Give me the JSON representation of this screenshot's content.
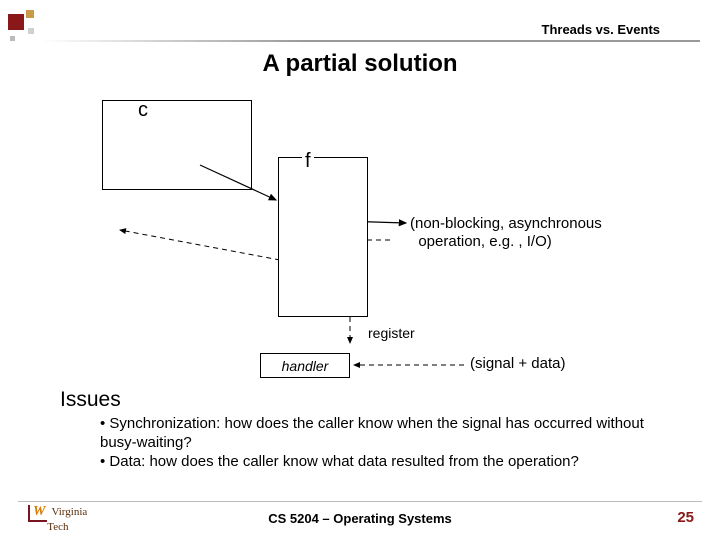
{
  "header": {
    "topic": "Threads vs. Events"
  },
  "title": "A partial solution",
  "diagram": {
    "c": "c",
    "f": "f",
    "handler": "handler",
    "register": "register",
    "async_note_l1": "(non-blocking, asynchronous",
    "async_note_l2": "operation, e.g. , I/O)",
    "signal_note": "(signal + data)"
  },
  "issues": {
    "heading": "Issues",
    "b1": "• Synchronization: how does the caller know when the signal has occurred without busy-waiting?",
    "b2": "• Data: how does the caller know what data resulted from the operation?"
  },
  "footer": {
    "course": "CS 5204 – Operating Systems",
    "page": "25",
    "logo_top": "Virginia",
    "logo_bot": "Tech",
    "logo_mark": "W"
  }
}
